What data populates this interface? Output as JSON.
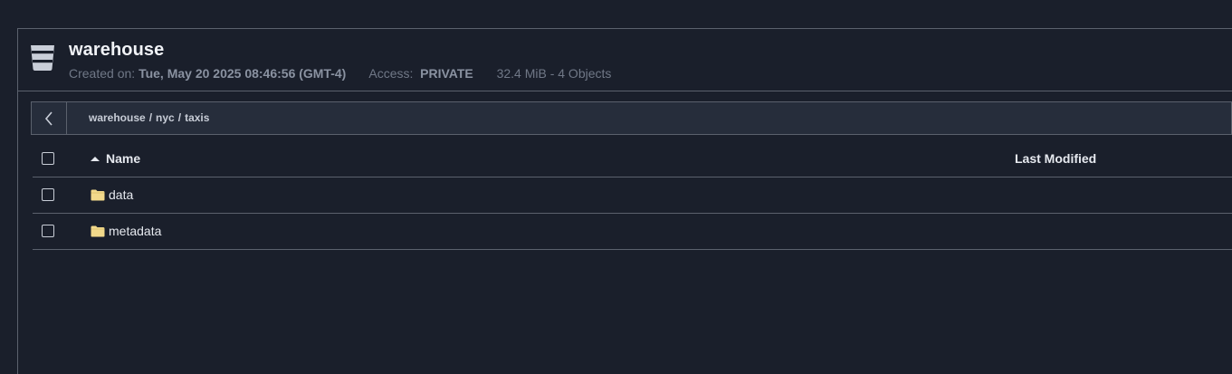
{
  "bucket": {
    "name": "warehouse",
    "icon": "bucket-icon",
    "created_label": "Created on:",
    "created_value": "Tue, May 20 2025 08:46:56 (GMT-4)",
    "access_label": "Access:",
    "access_value": "PRIVATE",
    "size_summary": "32.4 MiB - 4 Objects"
  },
  "breadcrumb": {
    "back_icon": "chevron-left-icon",
    "parts": [
      "warehouse",
      "nyc",
      "taxis"
    ],
    "separator": "/"
  },
  "table": {
    "columns": {
      "name": "Name",
      "last_modified": "Last Modified"
    },
    "sort_icon": "sort-ascending-icon",
    "rows": [
      {
        "name": "data",
        "icon": "folder-icon",
        "last_modified": ""
      },
      {
        "name": "metadata",
        "icon": "folder-icon",
        "last_modified": ""
      }
    ]
  },
  "colors": {
    "background": "#1a1f2b",
    "border": "#5b616d",
    "breadcrumb_bg": "#262d3b",
    "folder": "#f2d98b"
  }
}
